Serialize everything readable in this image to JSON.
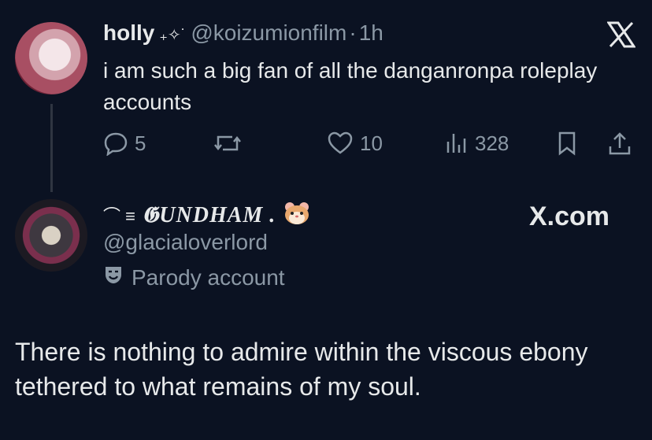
{
  "tweet1": {
    "display_name": "holly",
    "name_decoration": "₊✧˙",
    "handle": "@koizumionfilm",
    "separator": "·",
    "time": "1h",
    "text": "i am such a big fan of all the danganronpa roleplay accounts",
    "actions": {
      "replies": "5",
      "likes": "10",
      "views": "328"
    }
  },
  "tweet2": {
    "name_prefix": "⌒ ≡",
    "display_name": "𝕲UNDHAM .",
    "handle": "@glacialoverlord",
    "label": "Parody account",
    "text": "There is nothing to admire within the viscous ebony tethered to what remains of my soul."
  },
  "watermark": "X.com",
  "icons": {
    "x_logo": "x-logo-icon",
    "reply": "speech-bubble-icon",
    "repost": "repost-arrows-icon",
    "like": "heart-icon",
    "views": "bar-chart-icon",
    "bookmark": "bookmark-icon",
    "share": "share-upload-icon",
    "parody": "theater-mask-icon",
    "hamster": "hamster-face-emoji"
  },
  "colors": {
    "background": "#0b1222",
    "primary_text": "#e7e9ea",
    "secondary_text": "#8b98a5"
  }
}
